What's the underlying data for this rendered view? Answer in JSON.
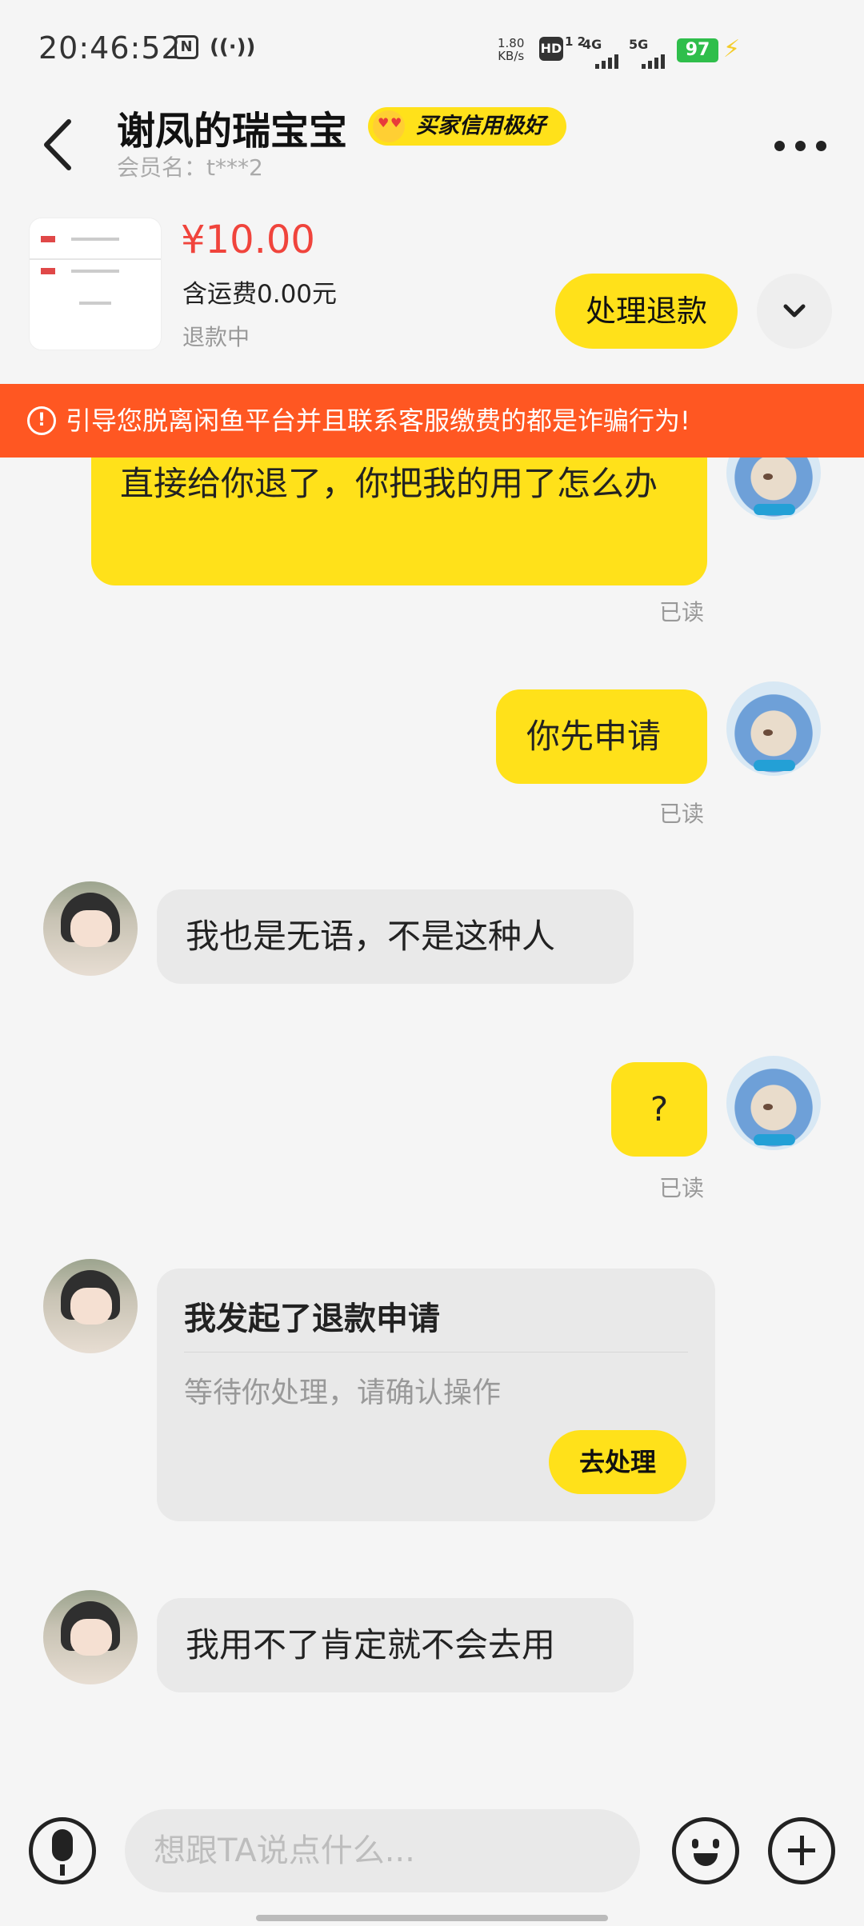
{
  "status_bar": {
    "time": "20:46:52",
    "nfc_icon": "N",
    "hotspot_icon": "((·))",
    "net_speed_value": "1.80",
    "net_speed_unit": "KB/s",
    "hd_label": "HD",
    "hd_sim": "1 2",
    "sim1_label": "4G",
    "sim2_label": "5G",
    "battery": "97",
    "battery_color": "#2fbe4b"
  },
  "header": {
    "title": "谢凤的瑞宝宝",
    "credit_badge": "买家信用极好",
    "member_name": "会员名：t***2"
  },
  "order": {
    "price": "¥10.00",
    "shipping": "含运费0.00元",
    "status": "退款中",
    "refund_button": "处理退款"
  },
  "warning": {
    "text": "引导您脱离闲鱼平台并且联系客服缴费的都是诈骗行为!",
    "icon": "!",
    "color": "#ff5722"
  },
  "messages": {
    "m1": "直接给你退了，你把我的用了怎么办",
    "m1_read": "已读",
    "m2": "你先申请",
    "m2_read": "已读",
    "m3": "我也是无语，不是这种人",
    "m4": "?",
    "m4_read": "已读",
    "refund_card_title": "我发起了退款申请",
    "refund_card_desc": "等待你处理，请确认操作",
    "refund_card_button": "去处理",
    "m6": "我用不了肯定就不会去用"
  },
  "input_bar": {
    "placeholder": "想跟TA说点什么..."
  },
  "accent_color": "#ffe11a",
  "price_color": "#f0443c"
}
